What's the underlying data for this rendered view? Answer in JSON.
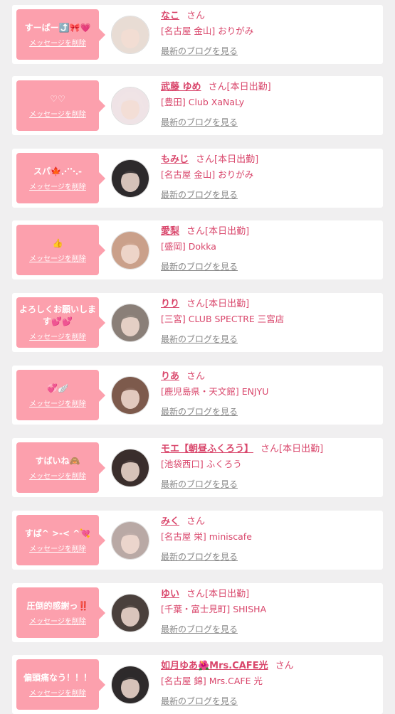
{
  "messages": [
    {
      "message": "すーぱー⤴️🎀💗",
      "delete_label": "メッセージを削除",
      "name": "なこ",
      "san": "さん",
      "status": "",
      "shop": "[名古屋 金山] おりがみ",
      "blog_label": "最新のブログを見る",
      "avatar_color": "#e8dcd4"
    },
    {
      "message": "♡♡",
      "delete_label": "メッセージを削除",
      "name": "武藤 ゆめ",
      "san": "さん",
      "status": "[本日出勤]",
      "shop": "[豊田] Club XaNaLy",
      "blog_label": "最新のブログを見る",
      "avatar_color": "#efe3e6"
    },
    {
      "message": "スパ🍁⋰⋱-",
      "delete_label": "メッセージを削除",
      "name": "もみじ",
      "san": "さん",
      "status": "[本日出勤]",
      "shop": "[名古屋 金山] おりがみ",
      "blog_label": "最新のブログを見る",
      "avatar_color": "#2d2a2c"
    },
    {
      "message": "👍",
      "delete_label": "メッセージを削除",
      "name": "愛梨",
      "san": "さん",
      "status": "[本日出勤]",
      "shop": "[盛岡] Dokka",
      "blog_label": "最新のブログを見る",
      "avatar_color": "#caa08a"
    },
    {
      "message": "よろしくお願いします💕💕",
      "delete_label": "メッセージを削除",
      "name": "りり",
      "san": "さん",
      "status": "[本日出勤]",
      "shop": "[三宮] CLUB SPECTRE 三宮店",
      "blog_label": "最新のブログを見る",
      "avatar_color": "#8a7f78"
    },
    {
      "message": "💞🪽",
      "delete_label": "メッセージを削除",
      "name": "りあ",
      "san": "さん",
      "status": "",
      "shop": "[鹿児島県・天文館] ENJYU",
      "blog_label": "最新のブログを見る",
      "avatar_color": "#7d5a4c"
    },
    {
      "message": "すばいね🙈",
      "delete_label": "メッセージを削除",
      "name": "モエ【朝昼ふくろう】",
      "san": "さん",
      "status": "[本日出勤]",
      "shop": "[池袋西口] ふくろう",
      "blog_label": "最新のブログを見る",
      "avatar_color": "#3a2e2c"
    },
    {
      "message": "すば^ >-< ^💘",
      "delete_label": "メッセージを削除",
      "name": "みく",
      "san": "さん",
      "status": "",
      "shop": "[名古屋 栄] miniscafe",
      "blog_label": "最新のブログを見る",
      "avatar_color": "#b9a9a5"
    },
    {
      "message": "圧倒的感謝っ‼️",
      "delete_label": "メッセージを削除",
      "name": "ゆい",
      "san": "さん",
      "status": "[本日出勤]",
      "shop": "[千葉・富士見町] SHISHA",
      "blog_label": "最新のブログを見る",
      "avatar_color": "#4a403c"
    },
    {
      "message": "偏頭痛なう！！！",
      "delete_label": "メッセージを削除",
      "name": "如月ゆあ🌺Mrs.CAFE光",
      "san": "さん",
      "status": "",
      "shop": "[名古屋 錦] Mrs.CAFE 光",
      "blog_label": "最新のブログを見る",
      "avatar_color": "#2e2a2b"
    }
  ]
}
